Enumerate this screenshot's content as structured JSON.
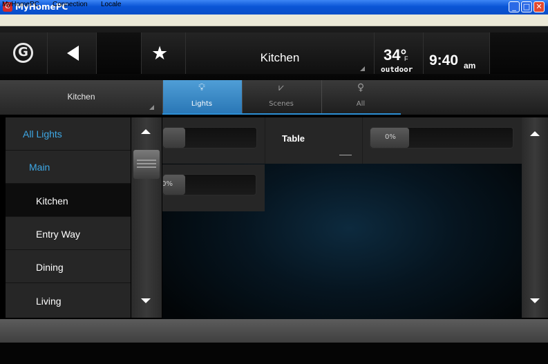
{
  "window": {
    "title": "MyHomePC",
    "app_icon_glyph": "G"
  },
  "menu": [
    "MyHomePC",
    "Connection",
    "Locale"
  ],
  "header": {
    "title": "Kitchen",
    "temperature": "34°",
    "temperature_unit": "F",
    "temperature_label": "outdoor",
    "time": "9:40",
    "time_suffix": "am"
  },
  "tabs": {
    "room_selector": "Kitchen",
    "items": [
      {
        "label": "Lights",
        "icon": "bulb-icon",
        "active": true
      },
      {
        "label": "Scenes",
        "icon": "scenes-icon",
        "active": false
      },
      {
        "label": "All",
        "icon": "all-lights-icon",
        "active": false
      }
    ]
  },
  "rooms": [
    {
      "label": "All Lights",
      "color": "#3ea8e6"
    },
    {
      "label": "Main",
      "color": "#3ea8e6"
    },
    {
      "label": "Kitchen",
      "color": "#ffffff",
      "selected": true
    },
    {
      "label": "Entry Way",
      "color": "#ffffff"
    },
    {
      "label": "Dining",
      "color": "#ffffff"
    },
    {
      "label": "Living",
      "color": "#ffffff"
    }
  ],
  "lights": {
    "table_name": "Table",
    "table_level": "0%",
    "second_level": "0%"
  },
  "colors": {
    "accent": "#2d8fd6",
    "active_tab": "#3d8fcc"
  }
}
